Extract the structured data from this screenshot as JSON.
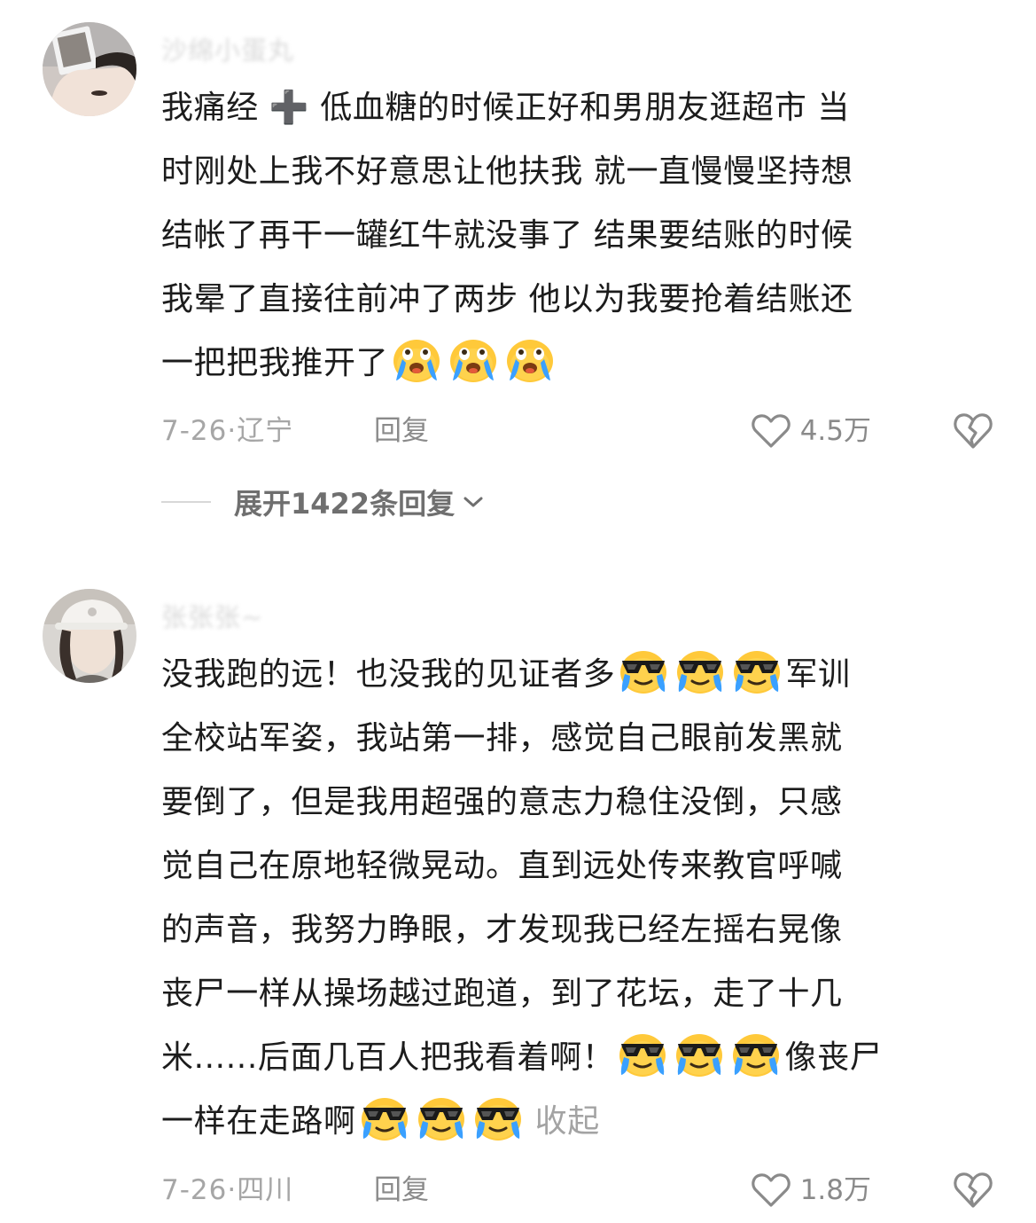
{
  "comments": [
    {
      "username": "沙绵小蛋丸",
      "lines": [
        "我痛经 ➕ 低血糖的时候正好和男朋友逛超市 当",
        "时刚处上我不好意思让他扶我 就一直慢慢坚持想",
        "结帐了再干一罐红牛就没事了 结果要结账的时候",
        "我晕了直接往前冲了两步 他以为我要抢着结账还",
        "一把把我推开了"
      ],
      "emojis": [
        "crying-emoji",
        "crying-emoji",
        "crying-emoji"
      ],
      "date": "7-26·辽宁",
      "reply_label": "回复",
      "likes": "4.5万",
      "expand_label": "展开1422条回复"
    },
    {
      "username": "张张张~",
      "lines": [
        "没我跑的远！也没我的见证者多",
        "军训",
        "全校站军姿，我站第一排，感觉自己眼前发黑就",
        "要倒了，但是我用超强的意志力稳住没倒，只感",
        "觉自己在原地轻微晃动。直到远处传来教官呼喊",
        "的声音，我努力睁眼，才发现我已经左摇右晃像",
        "丧尸一样从操场越过跑道，到了花坛，走了十几",
        "米......后面几百人把我看着啊！",
        "像丧尸",
        "一样在走路啊"
      ],
      "emojis": [
        "sunglasses-crying-emoji"
      ],
      "collapse_label": "收起",
      "date": "7-26·四川",
      "reply_label": "回复",
      "likes": "1.8万"
    }
  ],
  "colors": {
    "text": "#1c1c1c",
    "meta": "#a6a6a6",
    "action": "#8a8a8a",
    "emoji_face": "#ffc93a",
    "tears": "#3aa0ff"
  }
}
